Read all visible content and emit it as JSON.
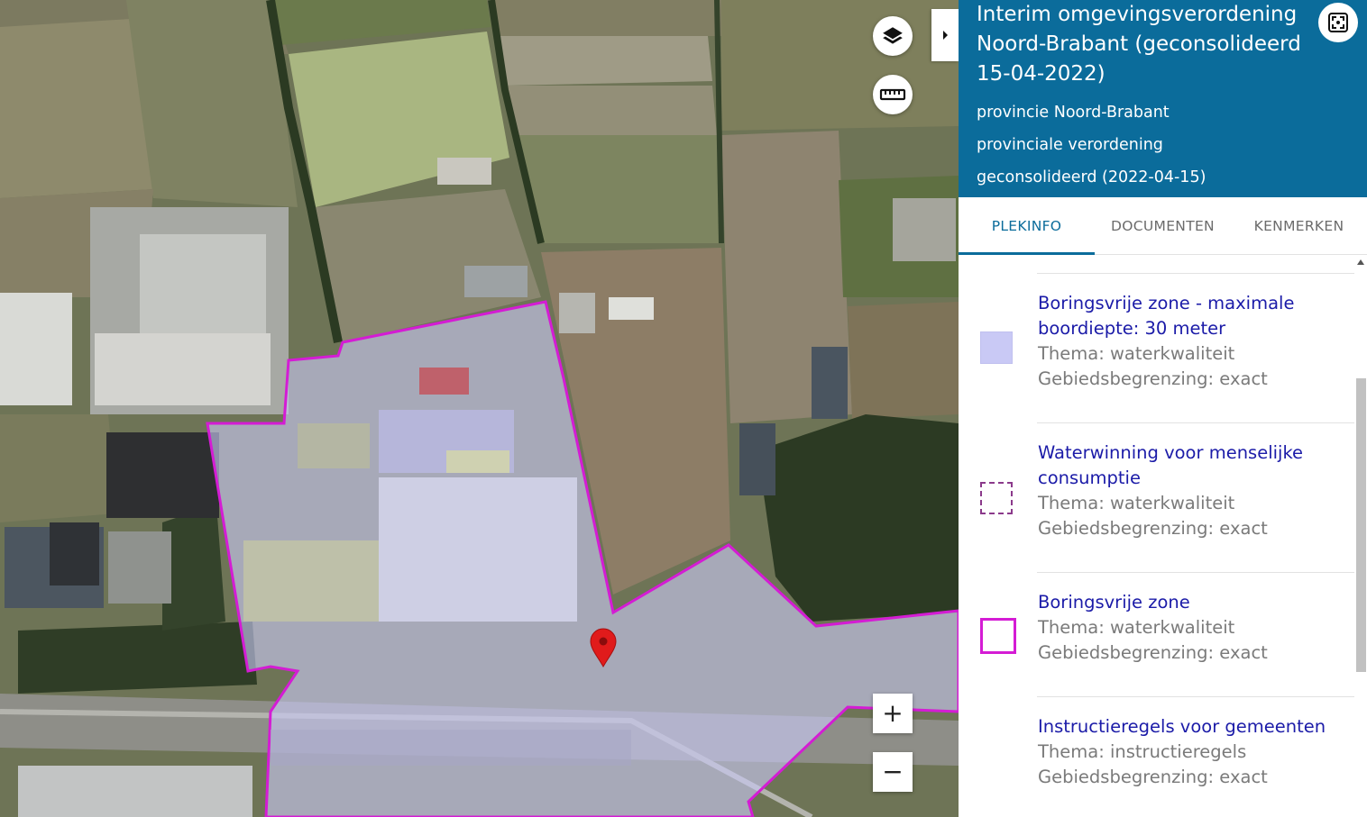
{
  "map": {
    "layers_button": "layers-icon",
    "measure_button": "ruler-icon",
    "zoom_in_label": "+",
    "zoom_out_label": "−",
    "panel_toggle": "chevron-right-icon",
    "marker": "map-pin-icon"
  },
  "panel": {
    "title": "Interim omgevingsverordening Noord-Brabant (geconsolideerd 15-04-2022)",
    "authority": "provincie Noord-Brabant",
    "type": "provinciale verordening",
    "status": "geconsolideerd (2022-04-15)",
    "fullscreen_button": "focus-frame-icon",
    "tabs": [
      {
        "label": "PLEKINFO",
        "active": true
      },
      {
        "label": "DOCUMENTEN",
        "active": false
      },
      {
        "label": "KENMERKEN",
        "active": false
      }
    ],
    "items": [
      {
        "title": "Boringsvrije zone - maximale boordiepte: 30 meter",
        "thema": "Thema: waterkwaliteit",
        "begrenzing": "Gebiedsbegrenzing: exact",
        "legend": "filled-lavender"
      },
      {
        "title": "Waterwinning voor menselijke consumptie",
        "thema": "Thema: waterkwaliteit",
        "begrenzing": "Gebiedsbegrenzing: exact",
        "legend": "dashed-purple"
      },
      {
        "title": "Boringsvrije zone",
        "thema": "Thema: waterkwaliteit",
        "begrenzing": "Gebiedsbegrenzing: exact",
        "legend": "outline-magenta"
      },
      {
        "title": "Instructieregels voor gemeenten",
        "thema": "Thema: instructieregels",
        "begrenzing": "Gebiedsbegrenzing: exact",
        "legend": "none"
      }
    ]
  },
  "colors": {
    "header": "#0b6c9b",
    "link": "#1b1ba8",
    "zone_fill": "#c9c9f5",
    "zone_border": "#d41cd4",
    "dashed_border": "#8b3a8b",
    "marker": "#e01b1b"
  }
}
